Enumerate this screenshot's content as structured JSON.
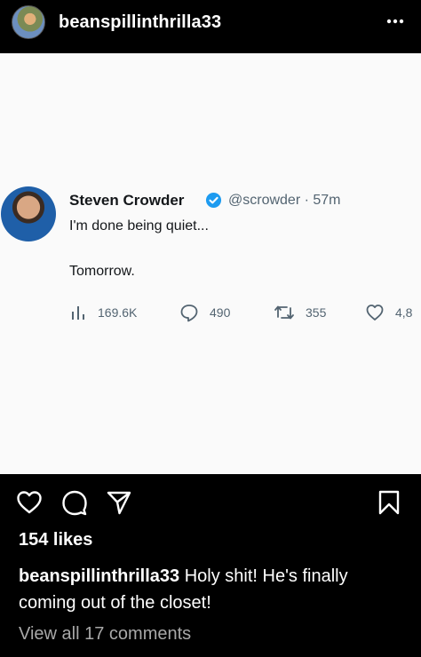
{
  "header": {
    "username": "beanspillinthrilla33",
    "more_icon": "more-horizontal-icon"
  },
  "tweet": {
    "author_name": "Steven Crowder",
    "handle_time": "@scrowder · 57m",
    "text_line1": "I'm done being quiet...",
    "text_line2": "Tomorrow.",
    "views": "169.6K",
    "replies": "490",
    "retweets": "355",
    "likes": "4,8",
    "verified_color": "#1d9bf0"
  },
  "actions": {
    "icons": [
      "heart-icon",
      "comment-icon",
      "share-icon",
      "bookmark-icon"
    ]
  },
  "likes_label": "154 likes",
  "caption": {
    "username": "beanspillinthrilla33",
    "text": " Holy shit! He's finally coming out of the closet!"
  },
  "view_comments": "View all 17 comments",
  "colors": {
    "background": "#000000",
    "tweet_background": "#fafafa",
    "muted_text": "#a8a8a8"
  }
}
